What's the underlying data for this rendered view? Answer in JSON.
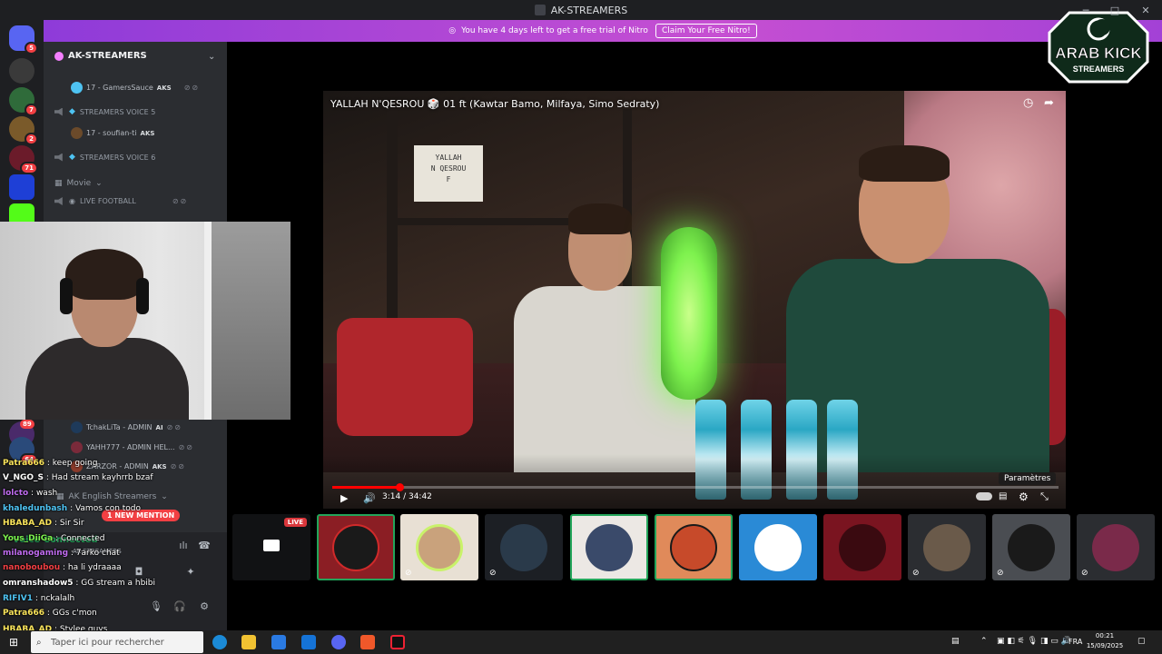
{
  "window": {
    "title": "AK-STREAMERS"
  },
  "banner": {
    "text": "You have 4 days left to get a free trial of Nitro",
    "button": "Claim Your Free Nitro!"
  },
  "rail": {
    "badges": [
      "5",
      "7",
      "2",
      "71"
    ]
  },
  "server": {
    "name": "AK-STREAMERS",
    "channels": [
      {
        "label": "STREAMERS VOICE 5"
      },
      {
        "label": "STREAMERS VOICE 6"
      },
      {
        "label": "Movie"
      },
      {
        "label": "LIVE FOOTBALL"
      },
      {
        "label": "AK English Streamers"
      }
    ],
    "users": [
      {
        "name": "17 - GamersSauce",
        "tag": "AKS"
      },
      {
        "name": "17 - soufian-ti",
        "tag": "AKS"
      },
      {
        "name": "TchakLiTa - ADMIN",
        "tag": "AI"
      },
      {
        "name": "YAHH777 - ADMIN HEL...",
        "tag": ""
      },
      {
        "name": "ZARZOR - ADMIN",
        "tag": "AKS"
      }
    ],
    "mention": "1 NEW MENTION",
    "badges_lower": [
      "89",
      "64"
    ]
  },
  "video": {
    "title": "YALLAH N'QESROU 🎲 01 ft (Kawtar Bamo, Milfaya, Simo Sedraty)",
    "time": "3:14 / 34:42",
    "progress": 0.093,
    "tooltip": "Paramètres",
    "sign_lines": [
      "YALLAH",
      "N QESROU",
      "F"
    ]
  },
  "tiles": {
    "live_label": "LIVE"
  },
  "chat": [
    {
      "name": "Patra666",
      "text": " : keep going",
      "color": "#f9e45b"
    },
    {
      "name": "V_NGO_S",
      "text": " : Had stream kayhrrb bzaf",
      "color": "#ffffff"
    },
    {
      "name": "lolcto",
      "text": " : wash",
      "color": "#c06cf0"
    },
    {
      "name": "HBABA_AD",
      "text": " : Sir Sir",
      "color": "#f9e45b"
    },
    {
      "name": "khaledunbash",
      "text": " : Vamos con todo",
      "color": "#4ec3f2"
    },
    {
      "name": "Yous_DiiGa",
      "text": " : Connected",
      "color": "#7ef24e"
    },
    {
      "name": "milanogaming",
      "text": " : 7arko chat",
      "color": "#c06cf0"
    },
    {
      "name": "nanoboubou",
      "text": " : ha li ydraaaa",
      "color": "#f23f43"
    },
    {
      "name": "omranshadow5",
      "text": " : GG stream a hbibi",
      "color": "#ffffff"
    },
    {
      "name": "RIFIV1",
      "text": " : nckalalh",
      "color": "#4ec3f2"
    },
    {
      "name": "Patra666",
      "text": " : GGs c'mon",
      "color": "#f9e45b"
    },
    {
      "name": "HBABA_AD",
      "text": " : Stylee guys",
      "color": "#f9e45b"
    }
  ],
  "userbar": {
    "voice_status": "Voice Connected",
    "channel": "AK-STREAMERS"
  },
  "logo": {
    "line1": "ARAB KICK",
    "line2": "STREAMERS"
  },
  "taskbar": {
    "search_placeholder": "Taper ici pour rechercher",
    "lang": "FRA",
    "time": "00:21",
    "date": "15/09/2025"
  },
  "colors": {
    "blurple": "#5865f2",
    "nitro": "#b845d3",
    "live": "#da373c",
    "green": "#23a55a"
  }
}
